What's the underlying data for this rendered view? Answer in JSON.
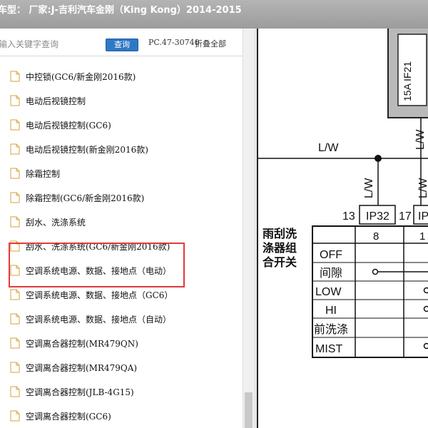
{
  "title": "车型：  厂家:J-吉利汽车金刚（King Kong）2014-2015",
  "search": {
    "placeholder": "输入关键字查询",
    "query_label": "查询",
    "pc_code": "PC.47-30740",
    "collapse_all": "折叠全部"
  },
  "tree_items": [
    "中控锁(GC6/新金刚2016款)",
    "电动后视镜控制",
    "电动后视镜控制(GC6)",
    "电动后视镜控制(新金刚2016款)",
    "除霜控制",
    "除霜控制(GC6/新金刚2016款)",
    "刮水、洗涤系统",
    "刮水、洗涤系统(GC6/新金刚2016款)",
    "空调系统电源、数据、接地点（电动）",
    "空调系统电源、数据、接地点（GC6）",
    "空调系统电源、数据、接地点（自动）",
    "空调离合器控制(MR479QN)",
    "空调离合器控制(MR479QA)",
    "空调离合器控制(JLB-4G15)",
    "空调离合器控制(GC6)"
  ],
  "diagram": {
    "fuse_label": "15A IF21",
    "wire_lw": "L/W",
    "conn_13": "13",
    "conn_ip32": "IP32",
    "conn_17": "17",
    "conn_ip_partial": "IP",
    "pin_8": "8",
    "pin_1_partial": "1",
    "switch_label": [
      "雨刮洗",
      "涤器组",
      "合开关"
    ],
    "modes": [
      "OFF",
      "间隙",
      "LOW",
      "HI",
      "前洗涤",
      "MIST"
    ]
  },
  "colors": {
    "highlight": "#e23a3a",
    "button": "#2f78c4",
    "fuse_fill": "#b9b9b9"
  }
}
